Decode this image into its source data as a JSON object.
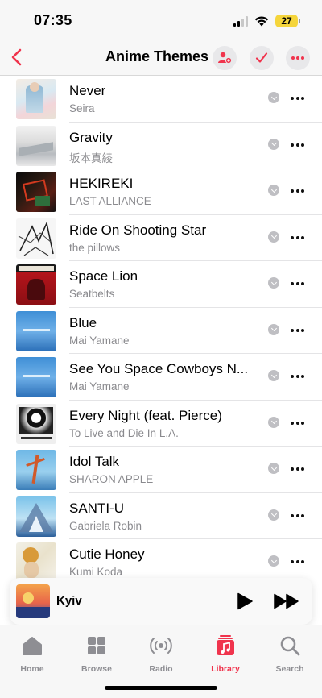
{
  "status_bar": {
    "time": "07:35",
    "battery": "27"
  },
  "header": {
    "title": "Anime Themes"
  },
  "tracks": [
    {
      "title": "Never",
      "artist": "Seira"
    },
    {
      "title": "Gravity",
      "artist": "坂本真綾"
    },
    {
      "title": "HEKIREKI",
      "artist": "LAST ALLIANCE"
    },
    {
      "title": "Ride On Shooting Star",
      "artist": "the pillows"
    },
    {
      "title": "Space Lion",
      "artist": "Seatbelts"
    },
    {
      "title": "Blue",
      "artist": "Mai Yamane"
    },
    {
      "title": "See You Space Cowboys N...",
      "artist": "Mai Yamane"
    },
    {
      "title": "Every Night (feat. Pierce)",
      "artist": "To Live and Die In L.A."
    },
    {
      "title": "Idol Talk",
      "artist": "SHARON APPLE"
    },
    {
      "title": "SANTI-U",
      "artist": "Gabriela Robin"
    },
    {
      "title": "Cutie Honey",
      "artist": "Kumi Koda"
    }
  ],
  "now_playing": {
    "title": "Kyiv"
  },
  "tabs": [
    {
      "label": "Home",
      "icon": "house-icon",
      "active": false
    },
    {
      "label": "Browse",
      "icon": "grid-icon",
      "active": false
    },
    {
      "label": "Radio",
      "icon": "radio-waves-icon",
      "active": false
    },
    {
      "label": "Library",
      "icon": "music-note-icon",
      "active": true
    },
    {
      "label": "Search",
      "icon": "search-icon",
      "active": false
    }
  ],
  "colors": {
    "accent": "#f0344d",
    "secondary_text": "#8a8a8e",
    "battery": "#f5d53b"
  }
}
